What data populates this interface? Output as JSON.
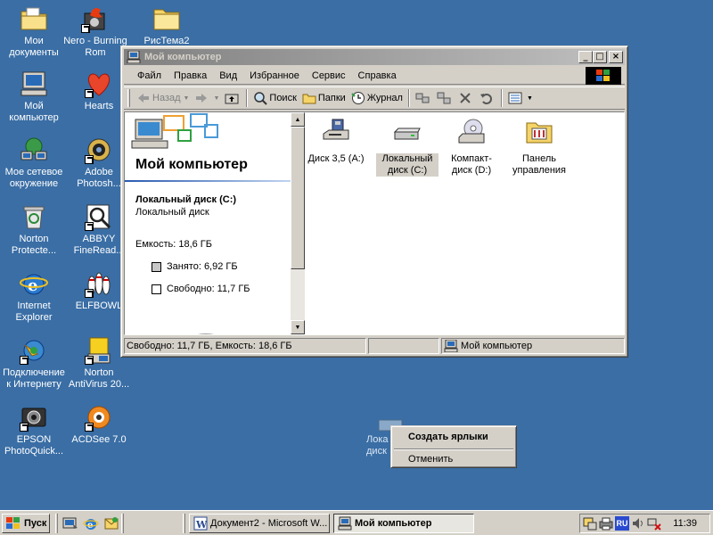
{
  "desktop": {
    "icons": [
      {
        "label": "Мои документы"
      },
      {
        "label": "Nero - Burning Rom"
      },
      {
        "label": "РисТема2"
      },
      {
        "label": "Мой компьютер"
      },
      {
        "label": "Hearts"
      },
      {
        "label": "Мое сетевое окружение"
      },
      {
        "label": "Adobe Photosh..."
      },
      {
        "label": "Norton Protecte..."
      },
      {
        "label": "ABBYY FineRead..."
      },
      {
        "label": "Internet Explorer"
      },
      {
        "label": "ELFBOWL"
      },
      {
        "label": "Подключение к Интернету"
      },
      {
        "label": "Norton AntiVirus 20..."
      },
      {
        "label": "EPSON PhotoQuick..."
      },
      {
        "label": "ACDSee 7.0"
      }
    ],
    "ghost_label": "Лока диск"
  },
  "window": {
    "title": "Мой компьютер",
    "buttons": {
      "minimize": "_",
      "maximize": "□",
      "close": "×"
    },
    "menu": [
      "Файл",
      "Правка",
      "Вид",
      "Избранное",
      "Сервис",
      "Справка"
    ],
    "toolbar": {
      "back": "Назад",
      "search": "Поиск",
      "folders": "Папки",
      "history": "Журнал"
    },
    "left_pane": {
      "title": "Мой компьютер",
      "disk_name": "Локальный диск (C:)",
      "disk_type": "Локальный диск",
      "capacity": "Емкость: 18,6 ГБ",
      "used": "Занято: 6,92 ГБ",
      "free": "Свободно: 11,7 ГБ"
    },
    "items": [
      {
        "label": "Диск 3,5 (A:)"
      },
      {
        "label": "Локальный диск (C:)"
      },
      {
        "label": "Компакт-диск (D:)"
      },
      {
        "label": "Панель управления"
      }
    ],
    "status": {
      "left": "Свободно: 11,7 ГБ, Емкость: 18,6 ГБ",
      "right": "Мой компьютер"
    }
  },
  "context_menu": {
    "items": [
      "Создать ярлыки",
      "Отменить"
    ]
  },
  "taskbar": {
    "start": "Пуск",
    "tasks": [
      "Документ2 - Microsoft W...",
      "Мой компьютер"
    ],
    "tray_lang": "RU",
    "clock": "11:39"
  },
  "colors": {
    "desktop": "#3a6ea5",
    "face": "#d4d0c8",
    "title_inactive_start": "#808080",
    "title_inactive_end": "#c0c0c0"
  }
}
